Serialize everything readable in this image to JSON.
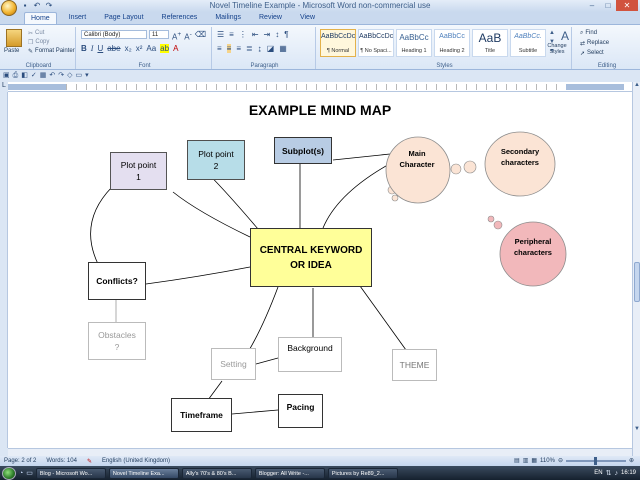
{
  "window": {
    "title": "Novel Timeline Example - Microsoft Word non-commercial use"
  },
  "ribbon": {
    "tabs": [
      "Home",
      "Insert",
      "Page Layout",
      "References",
      "Mailings",
      "Review",
      "View"
    ],
    "clipboard": {
      "paste": "Paste",
      "cut": "Cut",
      "copy": "Copy",
      "format_painter": "Format Painter",
      "label": "Clipboard"
    },
    "font": {
      "name": "Calibri (Body)",
      "size": "11",
      "label": "Font"
    },
    "paragraph": {
      "label": "Paragraph"
    },
    "styles": {
      "label": "Styles",
      "items": [
        {
          "sample": "AaBbCcDc",
          "name": "¶ Normal"
        },
        {
          "sample": "AaBbCcDc",
          "name": "¶ No Spaci..."
        },
        {
          "sample": "AaBbCc",
          "name": "Heading 1"
        },
        {
          "sample": "AaBbCc",
          "name": "Heading 2"
        },
        {
          "sample": "AaB",
          "name": "Title"
        },
        {
          "sample": "AaBbCc.",
          "name": "Subtitle"
        }
      ],
      "change_styles": "Change Styles"
    },
    "editing": {
      "find": "Find",
      "replace": "Replace",
      "select": "Select",
      "label": "Editing"
    }
  },
  "document": {
    "title": "EXAMPLE  MIND MAP",
    "nodes": {
      "plot1": "Plot point\n1",
      "plot2": "Plot point\n2",
      "subplots": "Subplot(s)",
      "main_character": "Main\nCharacter",
      "secondary": "Secondary\ncharacters",
      "peripheral": "Peripheral\ncharacters",
      "central": "CENTRAL KEYWORD\nOR IDEA",
      "conflicts": "Conflicts?",
      "obstacles": "Obstacles\n?",
      "setting": "Setting",
      "background": "Background",
      "theme": "THEME",
      "timeframe": "Timeframe",
      "pacing": "Pacing"
    }
  },
  "status": {
    "page": "Page: 2 of 2",
    "words": "Words: 104",
    "language": "English (United Kingdom)",
    "zoom": "110%"
  },
  "taskbar": {
    "tasks": [
      "Blog - Microsoft Wo...",
      "Novel Timeline Exa...",
      "Ally's 70's & 80's B...",
      "Blogger: All Write -...",
      "Pictures by Re89_2..."
    ],
    "time": "16:19",
    "language": "EN"
  },
  "colors": {
    "plot2_fill": "#b7dde8",
    "subplots_fill": "#b8cce4",
    "central_fill": "#ffff99",
    "main_char_fill": "#fbe4d5",
    "peripheral_fill": "#f2b8bb"
  }
}
